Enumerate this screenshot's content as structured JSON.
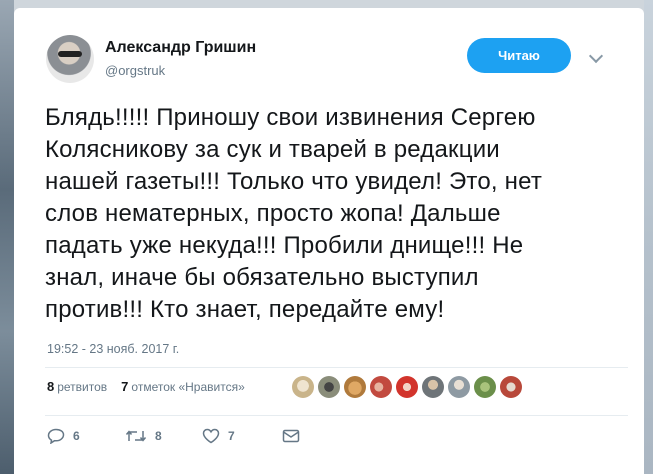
{
  "tweet": {
    "author_name": "Александр Гришин",
    "author_handle": "@orgstruk",
    "follow_label": "Читаю",
    "text_lines": [
      "Блядь!!!!! Приношу свои извинения Сергею",
      "Колясникову за сук и тварей в редакции",
      "нашей газеты!!! Только что увидел! Это, нет",
      "слов нематерных, просто жопа! Дальше",
      "падать уже некуда!!! Пробили днище!!! Не",
      "знал, иначе бы обязательно выступил",
      "против!!! Кто знает, передайте ему!"
    ],
    "timestamp": "19:52 - 23 нояб. 2017 г."
  },
  "stats": {
    "retweets_count": "8",
    "retweets_label": "ретвитов",
    "likes_count": "7",
    "likes_label": "отметок «Нравится»"
  },
  "actions": {
    "reply_count": "6",
    "retweet_count": "8",
    "like_count": "7"
  },
  "colors": {
    "accent": "#1da1f2",
    "text": "#14171a",
    "muted": "#657786"
  },
  "liker_avatars": [
    {
      "icon": "liker-avatar-dog",
      "color": "#c9b48a"
    },
    {
      "icon": "liker-avatar-cat",
      "color": "#8a8d7a"
    },
    {
      "icon": "liker-avatar-bear",
      "color": "#b07a3c"
    },
    {
      "icon": "liker-avatar-group",
      "color": "#c24a3f"
    },
    {
      "icon": "liker-avatar-red",
      "color": "#d2342c"
    },
    {
      "icon": "liker-avatar-portrait",
      "color": "#6e7478"
    },
    {
      "icon": "liker-avatar-person",
      "color": "#8e9aa3"
    },
    {
      "icon": "liker-avatar-green",
      "color": "#6b8f4a"
    },
    {
      "icon": "liker-avatar-flag",
      "color": "#b8483a"
    }
  ]
}
